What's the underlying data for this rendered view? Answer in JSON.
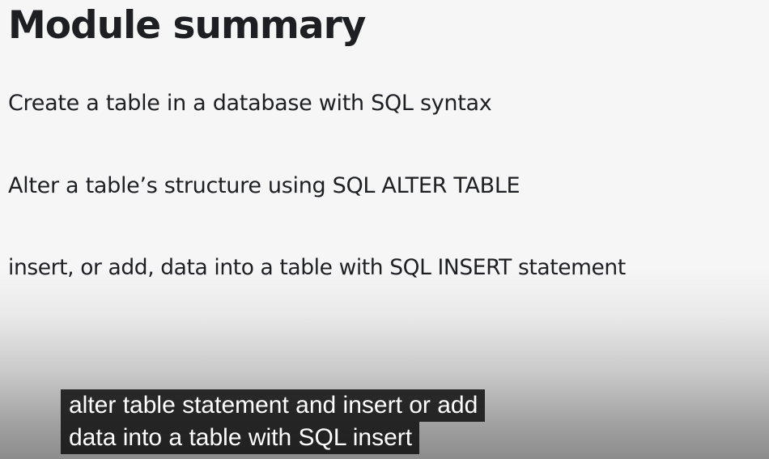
{
  "slide": {
    "title": "Module summary",
    "points": [
      "Create a table in a database with SQL syntax",
      "Alter a table’s structure using SQL ALTER TABLE",
      "insert, or add, data into a table with SQL INSERT statement"
    ]
  },
  "captions": {
    "lines": [
      "alter table statement and insert or add",
      "data into a table with SQL insert"
    ]
  }
}
